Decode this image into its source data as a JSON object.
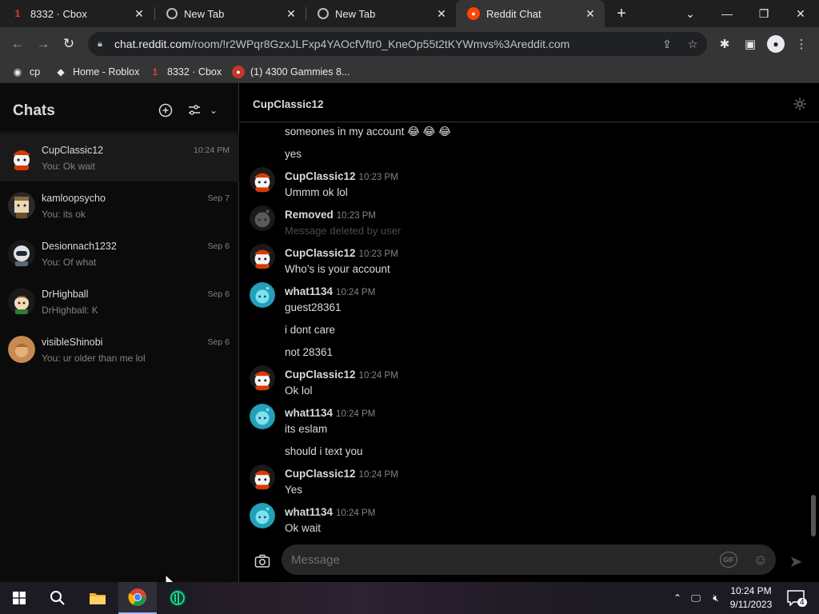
{
  "browser": {
    "tabs": [
      {
        "title": "8332 · Cbox",
        "favicon": "cbox-icon",
        "badge": "1"
      },
      {
        "title": "New Tab",
        "favicon": "chrome-icon"
      },
      {
        "title": "New Tab",
        "favicon": "chrome-icon"
      },
      {
        "title": "Reddit Chat",
        "favicon": "reddit-icon",
        "active": true
      }
    ],
    "url_host": "chat.reddit.com",
    "url_path": "/room/!r2WPqr8GzxJLFxp4YAOcfVftr0_KneOp55t2tKYWmvs%3Areddit.com",
    "bookmarks": [
      {
        "label": "cp",
        "icon": "globe-icon"
      },
      {
        "label": "Home - Roblox",
        "icon": "roblox-icon"
      },
      {
        "label": "8332 · Cbox",
        "icon": "cbox-icon",
        "badge": "1"
      },
      {
        "label": "(1) 4300 Gammies 8...",
        "icon": "avatar-icon"
      }
    ]
  },
  "sidebar": {
    "title": "Chats",
    "chats": [
      {
        "name": "CupClassic12",
        "preview": "You: Ok wait",
        "date": "10:24 PM",
        "active": true,
        "avatar": "red-cap"
      },
      {
        "name": "kamloopsycho",
        "preview": "You: its ok",
        "date": "Sep 7",
        "avatar": "box-head"
      },
      {
        "name": "Desionnach1232",
        "preview": "You: Of what",
        "date": "Sep 6",
        "avatar": "helmet"
      },
      {
        "name": "DrHighball",
        "preview": "DrHighball: K",
        "date": "Sep 6",
        "avatar": "brown-hair"
      },
      {
        "name": "visibleShinobi",
        "preview": "You: ur older than me lol",
        "date": "Sep 6",
        "avatar": "tan"
      }
    ]
  },
  "chat": {
    "title": "CupClassic12",
    "messages": [
      {
        "text": "someones in my account 😂 😂 😂"
      },
      {
        "text": "yes"
      },
      {
        "author": "CupClassic12",
        "time": "10:23 PM",
        "text": "Ummm ok lol",
        "avatar": "red-cap"
      },
      {
        "author": "Removed",
        "time": "10:23 PM",
        "text": "Message deleted by user",
        "avatar": "gray",
        "deleted": true
      },
      {
        "author": "CupClassic12",
        "time": "10:23 PM",
        "text": "Who’s is your account",
        "avatar": "red-cap"
      },
      {
        "author": "what1134",
        "time": "10:24 PM",
        "text": "guest28361",
        "avatar": "teal"
      },
      {
        "text": "i dont care"
      },
      {
        "text": "not 28361"
      },
      {
        "author": "CupClassic12",
        "time": "10:24 PM",
        "text": "Ok lol",
        "avatar": "red-cap"
      },
      {
        "author": "what1134",
        "time": "10:24 PM",
        "text": "its eslam",
        "avatar": "teal"
      },
      {
        "text": "should i text you"
      },
      {
        "author": "CupClassic12",
        "time": "10:24 PM",
        "text": "Yes",
        "avatar": "red-cap"
      },
      {
        "author": "what1134",
        "time": "10:24 PM",
        "text": "Ok wait",
        "avatar": "teal"
      }
    ],
    "composer_placeholder": "Message",
    "gif_label": "GIF"
  },
  "taskbar": {
    "time": "10:24 PM",
    "date": "9/11/2023",
    "notifications": "4"
  }
}
